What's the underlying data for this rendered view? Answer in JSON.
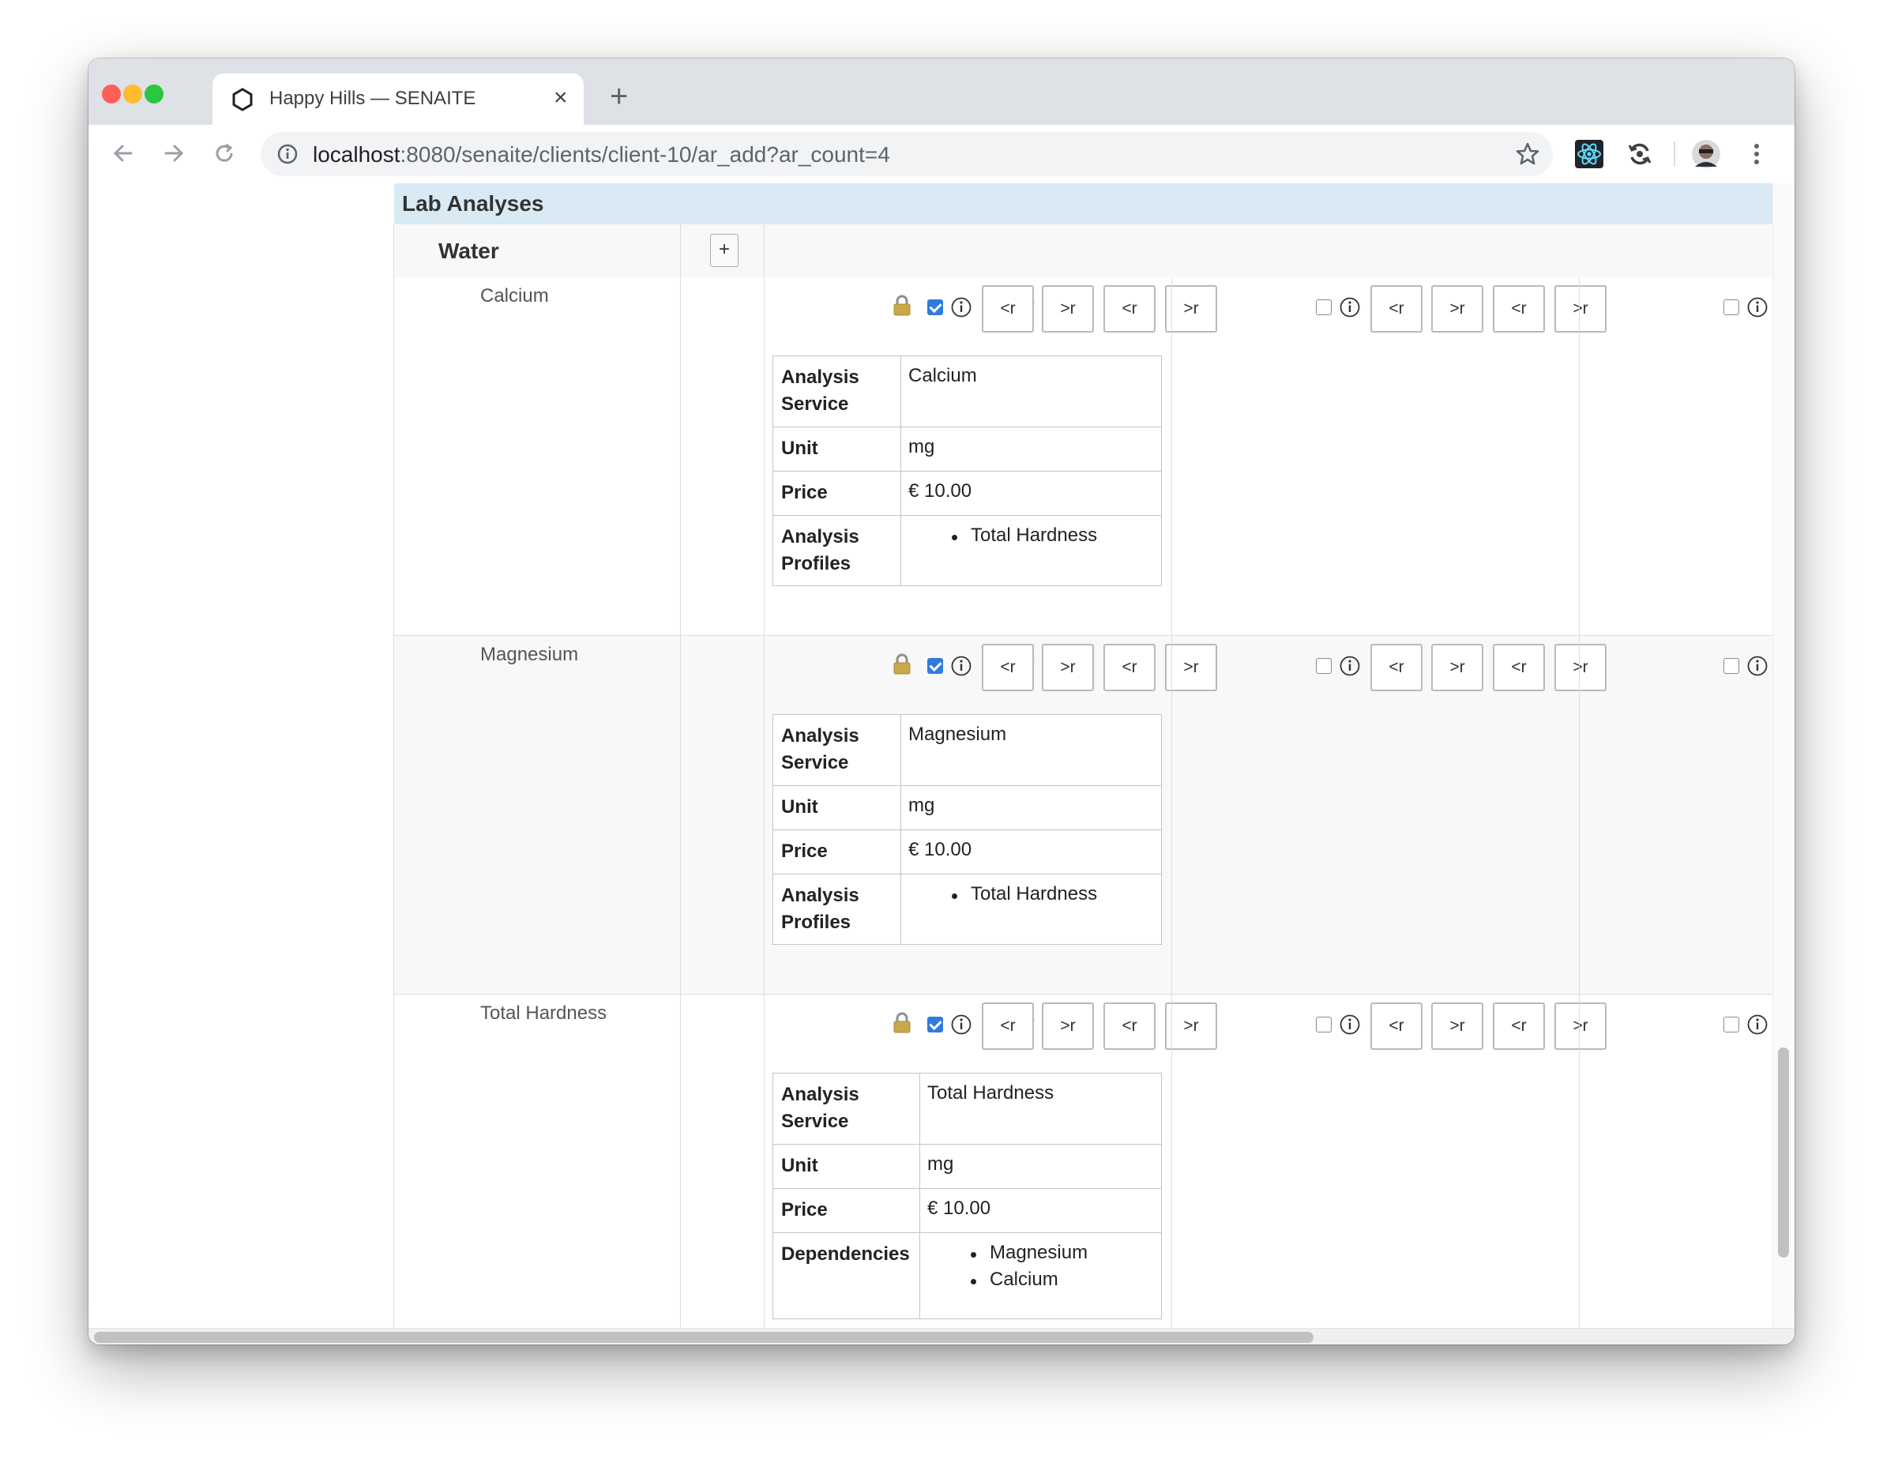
{
  "browser": {
    "tab_title": "Happy Hills — SENAITE",
    "tab_close": "×",
    "new_tab": "+",
    "url_host": "localhost",
    "url_path": ":8080/senaite/clients/client-10/ar_add?ar_count=4",
    "traffic_lights": {
      "close": "#ff5f57",
      "minimize": "#febc2e",
      "zoom": "#28c840"
    }
  },
  "panel": {
    "title": "Lab Analyses",
    "category": {
      "title": "Water",
      "expand_label": "+"
    }
  },
  "analyses": [
    {
      "name": "Calcium",
      "info": [
        {
          "key": "Analysis Service",
          "value": "Calcium"
        },
        {
          "key": "Unit",
          "value": "mg"
        },
        {
          "key": "Price",
          "value": "€ 10.00"
        },
        {
          "key": "Analysis Profiles",
          "items": [
            "Total Hardness"
          ]
        }
      ]
    },
    {
      "name": "Magnesium",
      "info": [
        {
          "key": "Analysis Service",
          "value": "Magnesium"
        },
        {
          "key": "Unit",
          "value": "mg"
        },
        {
          "key": "Price",
          "value": "€ 10.00"
        },
        {
          "key": "Analysis Profiles",
          "items": [
            "Total Hardness"
          ]
        }
      ]
    },
    {
      "name": "Total Hardness",
      "info": [
        {
          "key": "Analysis Service",
          "value": "Total Hardness"
        },
        {
          "key": "Unit",
          "value": "mg"
        },
        {
          "key": "Price",
          "value": "€ 10.00"
        },
        {
          "key": "Dependencies",
          "items": [
            "Magnesium",
            "Calcium"
          ]
        }
      ]
    }
  ],
  "range_buttons": [
    "<r",
    ">r",
    "<r",
    ">r"
  ],
  "columns": [
    {
      "checked": true,
      "locked": true
    },
    {
      "checked": false,
      "locked": false
    },
    {
      "checked": false,
      "locked": false
    }
  ],
  "icons": {
    "tab_favicon": "senaite-hexagon-icon",
    "back": "arrow-left-icon",
    "forward": "arrow-right-icon",
    "reload": "reload-icon",
    "site_info": "info-icon",
    "bookmark": "star-icon",
    "extensions": [
      "react-devtools-icon",
      "sync-icon",
      "avatar"
    ],
    "menu": "kebab-menu-icon",
    "copy": "fast-forward-icon",
    "lock": "lock-icon"
  },
  "colors": {
    "panel_header": "#d9eaf5",
    "checkbox_checked": "#2f7be0"
  }
}
